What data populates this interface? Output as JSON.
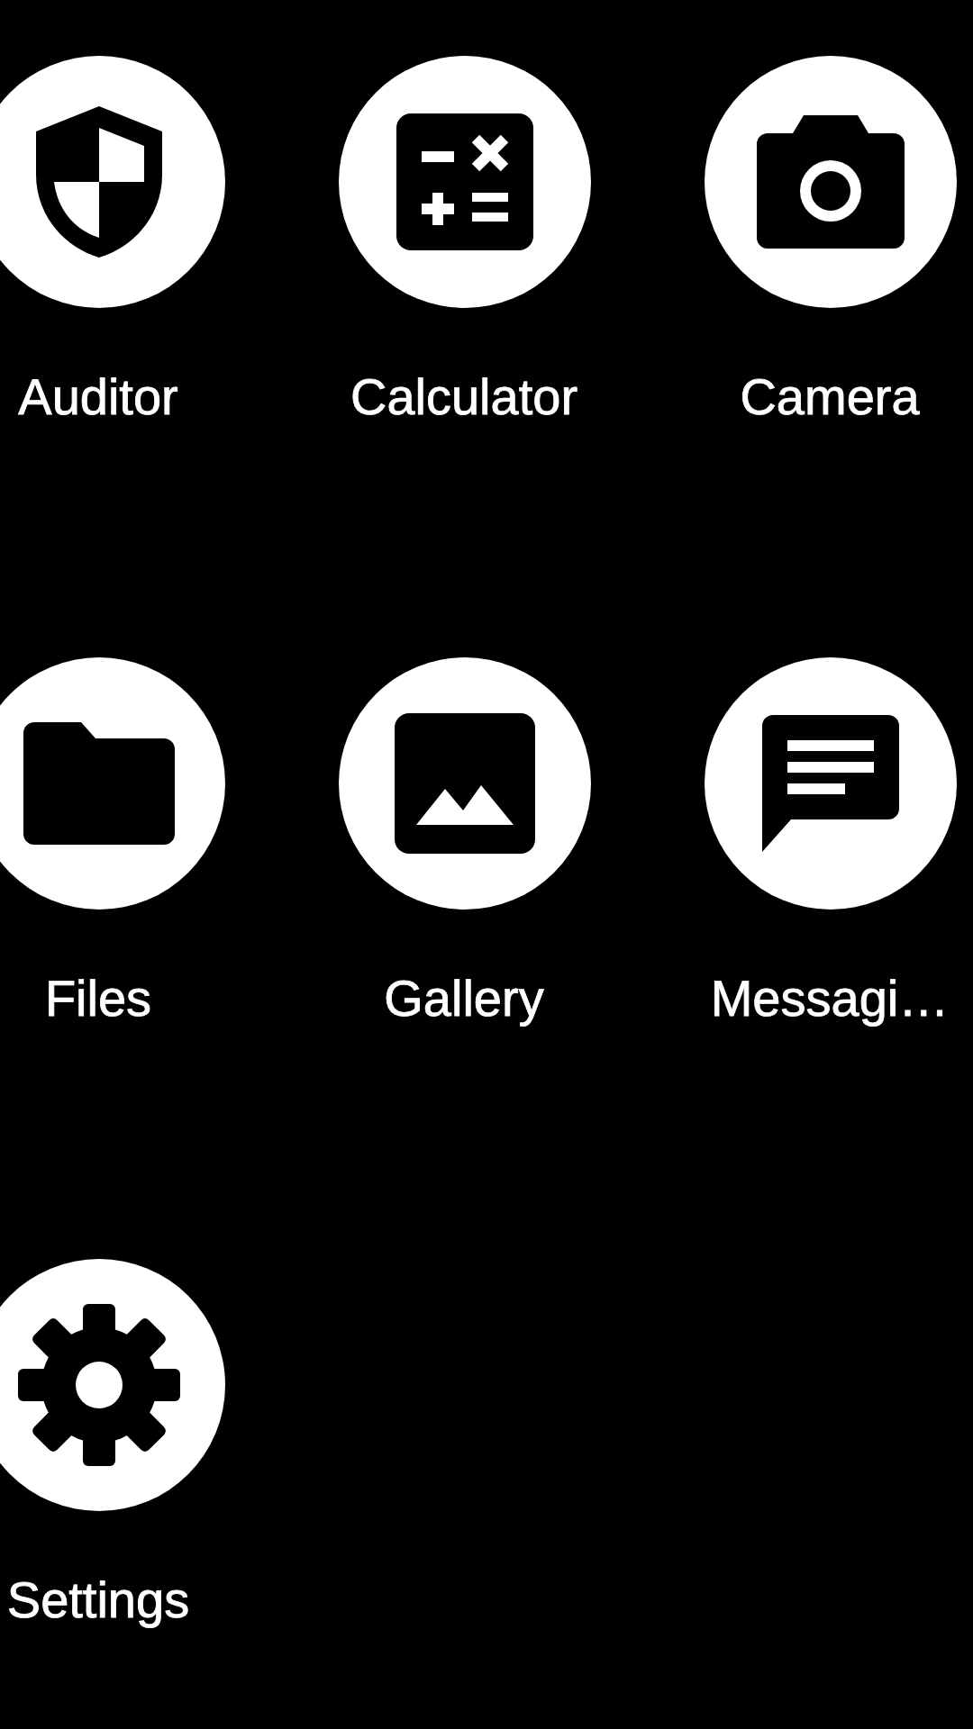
{
  "apps": [
    {
      "label": "Auditor"
    },
    {
      "label": "Calculator"
    },
    {
      "label": "Camera"
    },
    {
      "label": "Files"
    },
    {
      "label": "Gallery"
    },
    {
      "label": "Messagi…"
    },
    {
      "label": "Settings"
    }
  ]
}
